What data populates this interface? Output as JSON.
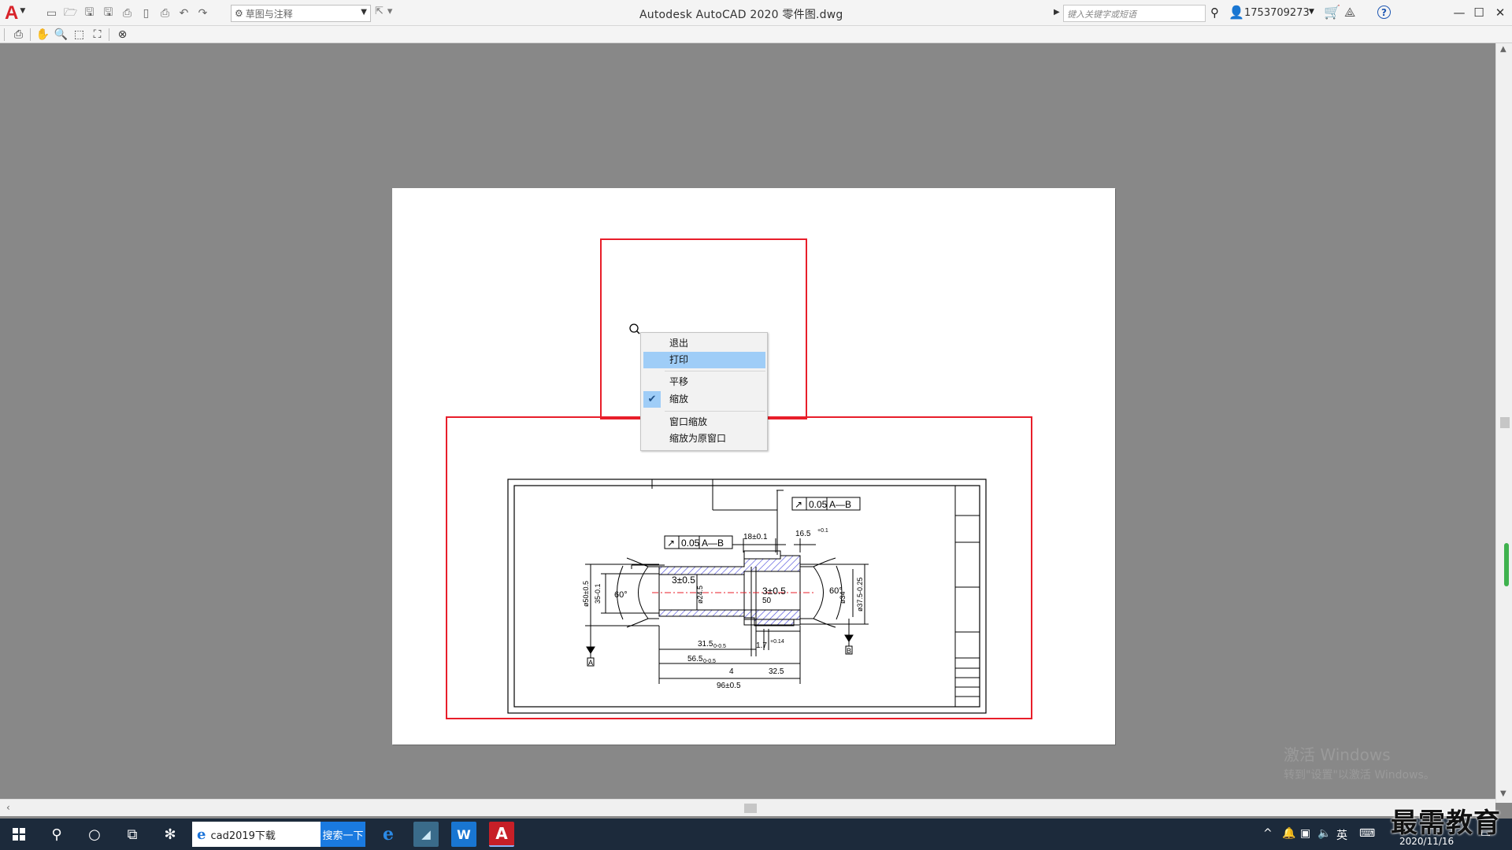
{
  "app": {
    "title": "Autodesk AutoCAD 2020    零件图.dwg",
    "logo_letter": "A",
    "workspace": "草图与注释",
    "search_placeholder": "键入关键字或短语",
    "user_id": "1753709273"
  },
  "titlebar_icons": {
    "qat": [
      "new-icon",
      "open-icon",
      "save-icon",
      "save-as-icon",
      "publish-icon",
      "plot-icon",
      "print-icon",
      "undo-icon",
      "redo-icon"
    ],
    "right": [
      "binoculars-icon",
      "user-icon",
      "cart-icon",
      "a360-icon",
      "help-icon",
      "minimize-icon",
      "maximize-icon",
      "close-icon"
    ]
  },
  "preview_toolbar": [
    "print-icon",
    "pan-icon",
    "zoom-icon",
    "zoom-window-icon",
    "zoom-original-icon",
    "close-preview-icon"
  ],
  "context_menu": {
    "items": [
      {
        "label": "退出",
        "selected": false,
        "checked": false
      },
      {
        "label": "打印",
        "selected": true,
        "checked": false
      },
      {
        "label": "平移",
        "selected": false,
        "checked": false
      },
      {
        "label": "缩放",
        "selected": false,
        "checked": true
      },
      {
        "label": "窗口缩放",
        "selected": false,
        "checked": false
      },
      {
        "label": "缩放为原窗口",
        "selected": false,
        "checked": false
      }
    ]
  },
  "drawing": {
    "tol_1": "0.05",
    "datum_ab": "A—B",
    "tol_2": "0.05",
    "dim_18": "18±0.1",
    "dim_165": "16.5",
    "dim_165_tol": "+0.1",
    "dim_3_left": "3±0.5",
    "dim_3_right": "3±0.5",
    "dim_50": "50",
    "dim_60_left": "60°",
    "dim_60_right": "60°",
    "dia_50": "ø50±0.5",
    "dia_35": "35-0.1",
    "dia_24": "ø24.5",
    "dia_34": "ø34",
    "dia_375": "ø37.5-0.25",
    "dim_315": "31.5",
    "dim_315_tol": "0-0.5",
    "dim_17": "1.7",
    "dim_17_tol": "+0.14",
    "dim_565": "56.5",
    "dim_565_tol": "0-0.5",
    "dim_4": "4",
    "dim_325": "32.5",
    "dim_96": "96±0.5",
    "datum_a": "A",
    "datum_b": "B"
  },
  "activation": {
    "line1": "激活 Windows",
    "line2": "转到\"设置\"以激活 Windows。"
  },
  "taskbar": {
    "search_text": "cad2019下载",
    "search_button": "搜索一下",
    "ime": "英",
    "time": "",
    "date": "2020/11/16"
  },
  "watermark": "最需教育",
  "colors": {
    "highlight_red": "#e81e2a",
    "menu_selected": "#9fcdf7",
    "taskbar": "#1c2a3b",
    "canvas": "#888888",
    "hatch_blue": "#3b3bd8",
    "autocad_red": "#d8232a"
  }
}
